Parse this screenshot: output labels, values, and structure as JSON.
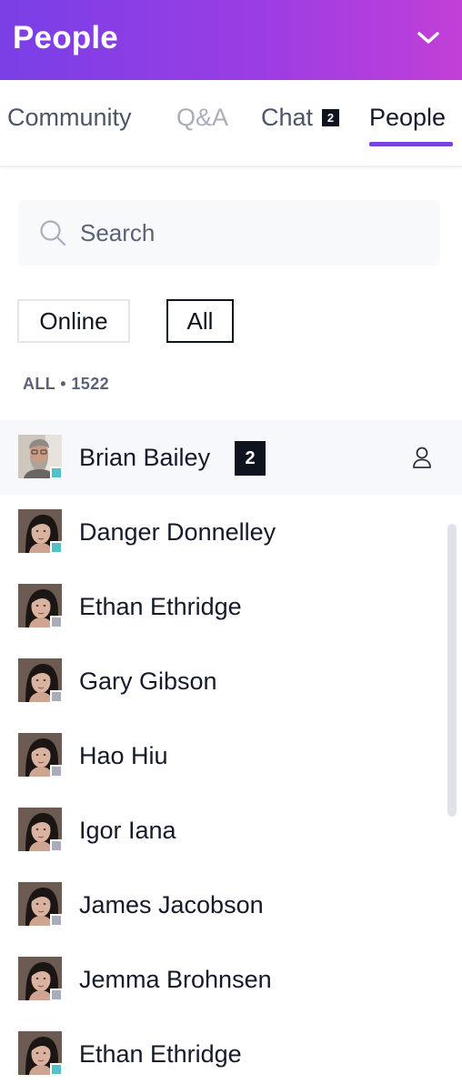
{
  "header": {
    "title": "People"
  },
  "tabs": [
    {
      "label": "Community"
    },
    {
      "label": "Q&A"
    },
    {
      "label": "Chat",
      "badge": "2"
    },
    {
      "label": "People",
      "active": true
    }
  ],
  "search": {
    "placeholder": "Search",
    "value": ""
  },
  "filters": {
    "online": "Online",
    "all": "All",
    "selected": "All"
  },
  "count_label": "ALL • 1522",
  "people": [
    {
      "name": "Brian Bailey",
      "status": "online",
      "badge": "2",
      "highlighted": true,
      "avatar": "bearded-man-avatar"
    },
    {
      "name": "Danger Donnelley",
      "status": "online",
      "avatar": "woman-avatar"
    },
    {
      "name": "Ethan Ethridge",
      "status": "offline",
      "avatar": "woman-avatar"
    },
    {
      "name": "Gary Gibson",
      "status": "offline",
      "avatar": "woman-avatar"
    },
    {
      "name": "Hao Hiu",
      "status": "offline",
      "avatar": "woman-avatar"
    },
    {
      "name": "Igor Iana",
      "status": "offline",
      "avatar": "woman-avatar"
    },
    {
      "name": "James Jacobson",
      "status": "offline",
      "avatar": "woman-avatar"
    },
    {
      "name": "Jemma Brohnsen",
      "status": "offline",
      "avatar": "woman-avatar"
    },
    {
      "name": "Ethan Ethridge",
      "status": "online",
      "avatar": "woman-avatar"
    }
  ],
  "colors": {
    "header_gradient_start": "#7a3fe6",
    "header_gradient_end": "#c23fd8",
    "accent": "#7b3fe4",
    "online": "#52c2c6",
    "offline": "#a9adba"
  }
}
